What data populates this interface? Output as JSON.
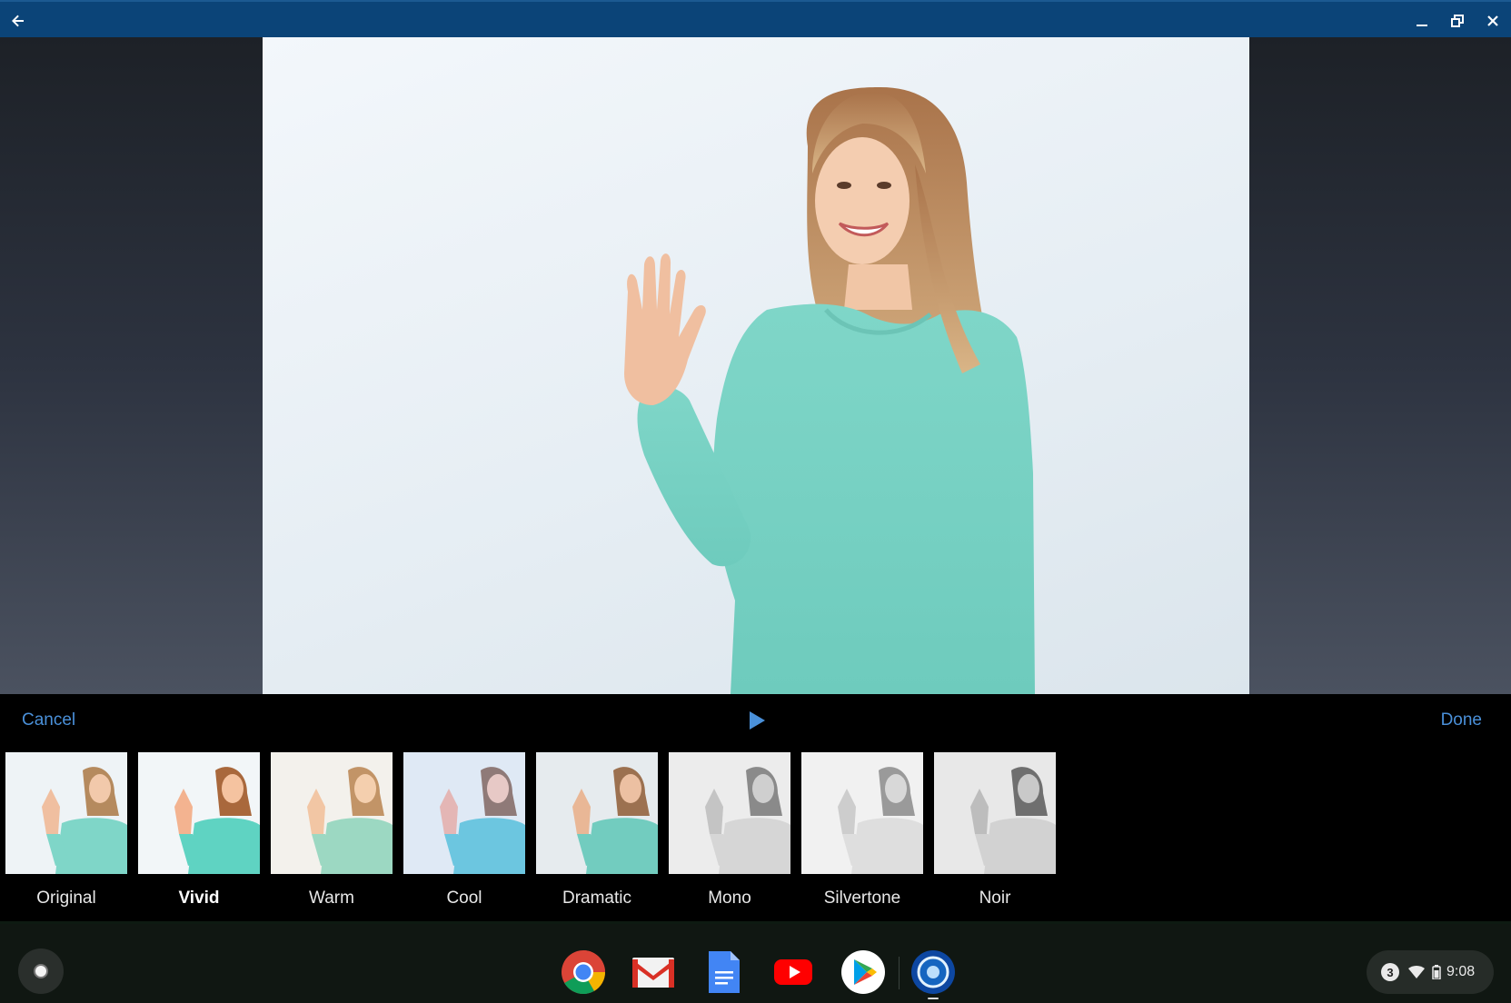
{
  "titlebar": {
    "icons": [
      "back-arrow-icon",
      "minimize-icon",
      "restore-icon",
      "close-icon"
    ],
    "color": "#0b4478"
  },
  "viewer": {
    "photo_description_color_top": "#f3f7fb"
  },
  "toolbar": {
    "cancel_label": "Cancel",
    "done_label": "Done",
    "play_icon": "play-icon",
    "accent": "#4a90d9"
  },
  "filters": {
    "selected": "Vivid",
    "items": [
      {
        "label": "Original"
      },
      {
        "label": "Vivid"
      },
      {
        "label": "Warm"
      },
      {
        "label": "Cool"
      },
      {
        "label": "Dramatic"
      },
      {
        "label": "Mono"
      },
      {
        "label": "Silvertone"
      },
      {
        "label": "Noir"
      }
    ]
  },
  "shelf": {
    "apps": [
      "chrome-icon",
      "gmail-icon",
      "docs-icon",
      "youtube-icon",
      "play-store-icon",
      "camera-app-icon"
    ],
    "notification_count": "3",
    "time": "9:08",
    "status_icons": [
      "wifi-icon",
      "battery-icon"
    ]
  }
}
